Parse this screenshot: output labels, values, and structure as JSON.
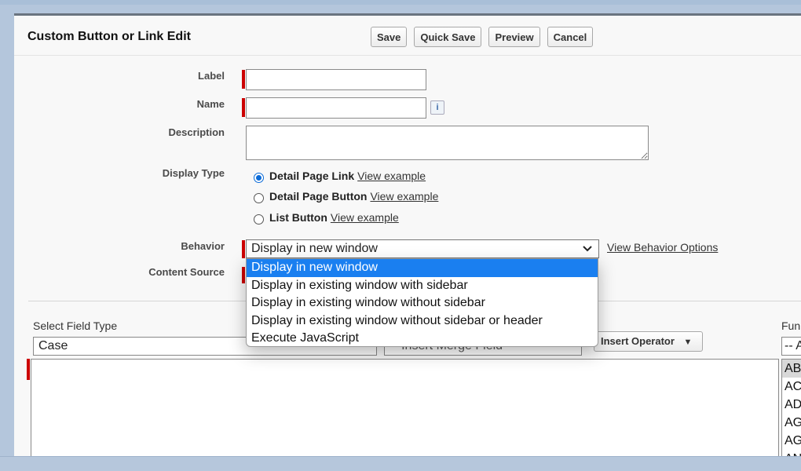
{
  "page": {
    "title": "Custom Button or Link Edit",
    "buttons": {
      "save": "Save",
      "quick_save": "Quick Save",
      "preview": "Preview",
      "cancel": "Cancel"
    }
  },
  "form": {
    "label": {
      "label": "Label",
      "value": ""
    },
    "name": {
      "label": "Name",
      "value": "",
      "info_icon": "i"
    },
    "description": {
      "label": "Description",
      "value": ""
    },
    "display_type": {
      "label": "Display Type",
      "options": [
        {
          "label": "Detail Page Link",
          "link": "View example",
          "checked": true
        },
        {
          "label": "Detail Page Button",
          "link": "View example",
          "checked": false
        },
        {
          "label": "List Button",
          "link": "View example",
          "checked": false
        }
      ]
    },
    "behavior": {
      "label": "Behavior",
      "selected": "Display in new window",
      "options_link": "View Behavior Options",
      "dropdown_options": [
        "Display in new window",
        "Display in existing window with sidebar",
        "Display in existing window without sidebar",
        "Display in existing window without sidebar or header",
        "Execute JavaScript"
      ]
    },
    "content_source": {
      "label": "Content Source"
    }
  },
  "formula": {
    "field_type": {
      "label": "Select Field Type",
      "value": "Case"
    },
    "merge_field": {
      "value": "-- Insert Merge Field --"
    },
    "operator_button": "Insert Operator",
    "functions": {
      "label": "Fun",
      "select_value": "-- A",
      "items": [
        "AB",
        "AC",
        "AD",
        "AG",
        "AG",
        "AN"
      ]
    }
  },
  "colors": {
    "required": "#cc0000",
    "selected_option": "#1a7ff0",
    "radio_checked": "#0b6bd8"
  }
}
